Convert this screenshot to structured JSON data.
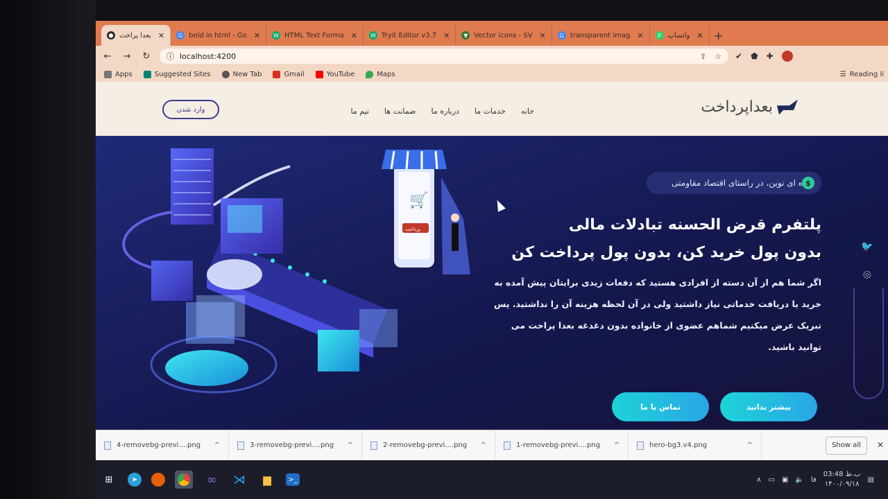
{
  "browser": {
    "tabs": [
      {
        "label": "بعدا پراخت",
        "icon": "app-icon",
        "color": "#2b2b2b"
      },
      {
        "label": "bold in html - Go",
        "icon": "google-icon",
        "color": "#4285f4"
      },
      {
        "label": "HTML Text Forma",
        "icon": "w3schools-icon",
        "color": "#04aa6d"
      },
      {
        "label": "Tryit Editor v3.7",
        "icon": "w3schools-icon",
        "color": "#04aa6d"
      },
      {
        "label": "Vector icons - SV",
        "icon": "vector-icon",
        "color": "#2e7d32"
      },
      {
        "label": "transparent imag",
        "icon": "google-icon",
        "color": "#4285f4"
      },
      {
        "label": "واتساپ",
        "icon": "whatsapp-icon",
        "color": "#25d366"
      }
    ],
    "url": "localhost:4200",
    "bookmarks": [
      {
        "label": "Apps",
        "icon": "apps-icon",
        "color": "#777"
      },
      {
        "label": "Suggested Sites",
        "icon": "bing-icon",
        "color": "#008373"
      },
      {
        "label": "New Tab",
        "icon": "globe-icon",
        "color": "#555"
      },
      {
        "label": "Gmail",
        "icon": "gmail-icon",
        "color": "#d93025"
      },
      {
        "label": "YouTube",
        "icon": "youtube-icon",
        "color": "#ff0000"
      },
      {
        "label": "Maps",
        "icon": "maps-icon",
        "color": "#34a853"
      }
    ],
    "reading_list": "Reading li"
  },
  "site": {
    "logo_text": "بعداپرداخت",
    "menu": [
      "خانه",
      "خدمات ما",
      "درباره ما",
      "ضمانت ها",
      "تیم ما"
    ],
    "login_label": "وارد شدن",
    "badge": "ایده ای نوین، در راستای اقتصاد مقاومتی",
    "title": "پلتفرم قرض الحسنه تبادلات مالی",
    "subtitle": "بدون پول خرید کن، بدون پول پرداخت کن",
    "text": "اگر شما هم از آن دسته از افرادی هستید که دفعات زیدی برایتان پیش آمده به خرید یا دریافت خدماتی نیاز داشتید ولی در آن لحظه هزینه آن را نداشتید. پس تبریک عرض میکنیم شماهم عضوی از خانواده بدون دغدغه بعدا پراخت می توانید باشید.",
    "btn_more": "بیشتر بدانید",
    "btn_contact": "تماس با ما",
    "sign_text": "پرداخت"
  },
  "downloads": {
    "files": [
      "4-removebg-previ....png",
      "3-removebg-previ....png",
      "2-removebg-previ....png",
      "1-removebg-previ....png",
      "hero-bg3.v4.png"
    ],
    "show_all": "Show all"
  },
  "taskbar": {
    "apps": [
      "windows-icon",
      "telegram-icon",
      "firefox-icon",
      "chrome-icon",
      "visual-studio-icon",
      "vscode-icon",
      "file-explorer-icon",
      "powershell-icon"
    ],
    "lang": "فا",
    "time": "03:48 ب.ظ",
    "date": "۱۴۰۰/۰۹/۱۸"
  },
  "colors": {
    "accent": "#1dd3d8",
    "hero_bg": "#1f2a78",
    "tab_strip": "#e07a4f"
  }
}
